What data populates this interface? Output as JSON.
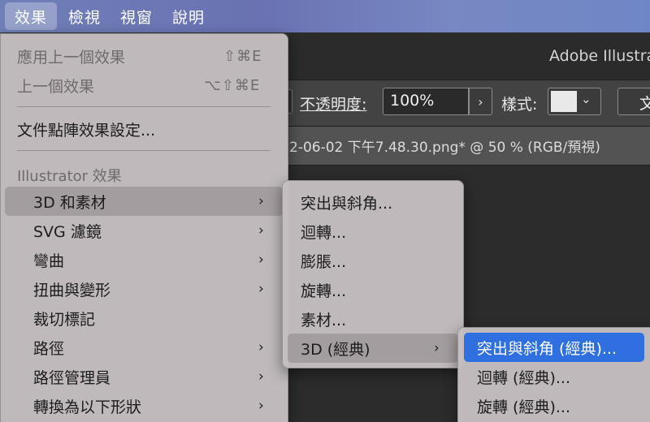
{
  "menubar": {
    "items": [
      {
        "label": "效果"
      },
      {
        "label": "檢視"
      },
      {
        "label": "視窗"
      },
      {
        "label": "說明"
      }
    ]
  },
  "app": {
    "title": "Adobe Illustrator",
    "opacity_label": "不透明度:",
    "opacity_value": "100%",
    "opacity_arrow": "›",
    "style_label": "樣式:",
    "style_chevron": "⌄",
    "right_button_label": "文",
    "doc_tab": "2-06-02 下午7.48.30.png* @ 50 % (RGB/預視)"
  },
  "effect_menu": {
    "apply_last": {
      "label": "應用上一個效果",
      "shortcut": "⇧⌘E"
    },
    "last_effect": {
      "label": "上一個效果",
      "shortcut": "⌥⇧⌘E"
    },
    "doc_raster_settings": {
      "label": "文件點陣效果設定..."
    },
    "section_illustrator": "Illustrator 效果",
    "items": [
      {
        "label": "3D 和素材",
        "arrow": "›"
      },
      {
        "label": "SVG 濾鏡",
        "arrow": "›"
      },
      {
        "label": "彎曲",
        "arrow": "›"
      },
      {
        "label": "扭曲與變形",
        "arrow": "›"
      },
      {
        "label": "裁切標記",
        "arrow": ""
      },
      {
        "label": "路徑",
        "arrow": "›"
      },
      {
        "label": "路徑管理員",
        "arrow": "›"
      },
      {
        "label": "轉換為以下形狀",
        "arrow": "›"
      }
    ]
  },
  "submenu_3d": {
    "items": [
      {
        "label": "突出與斜角..."
      },
      {
        "label": "迴轉..."
      },
      {
        "label": "膨脹..."
      },
      {
        "label": "旋轉..."
      },
      {
        "label": "素材..."
      },
      {
        "label": "3D (經典)",
        "arrow": "›"
      }
    ]
  },
  "submenu_3d_classic": {
    "items": [
      {
        "label": "突出與斜角 (經典)..."
      },
      {
        "label": "迴轉 (經典)..."
      },
      {
        "label": "旋轉 (經典)..."
      }
    ]
  },
  "colors": {
    "menu_bg": "#c4bec0",
    "highlight_blue": "#2f6fe0",
    "menubar_accent": "#6f7fb8"
  }
}
